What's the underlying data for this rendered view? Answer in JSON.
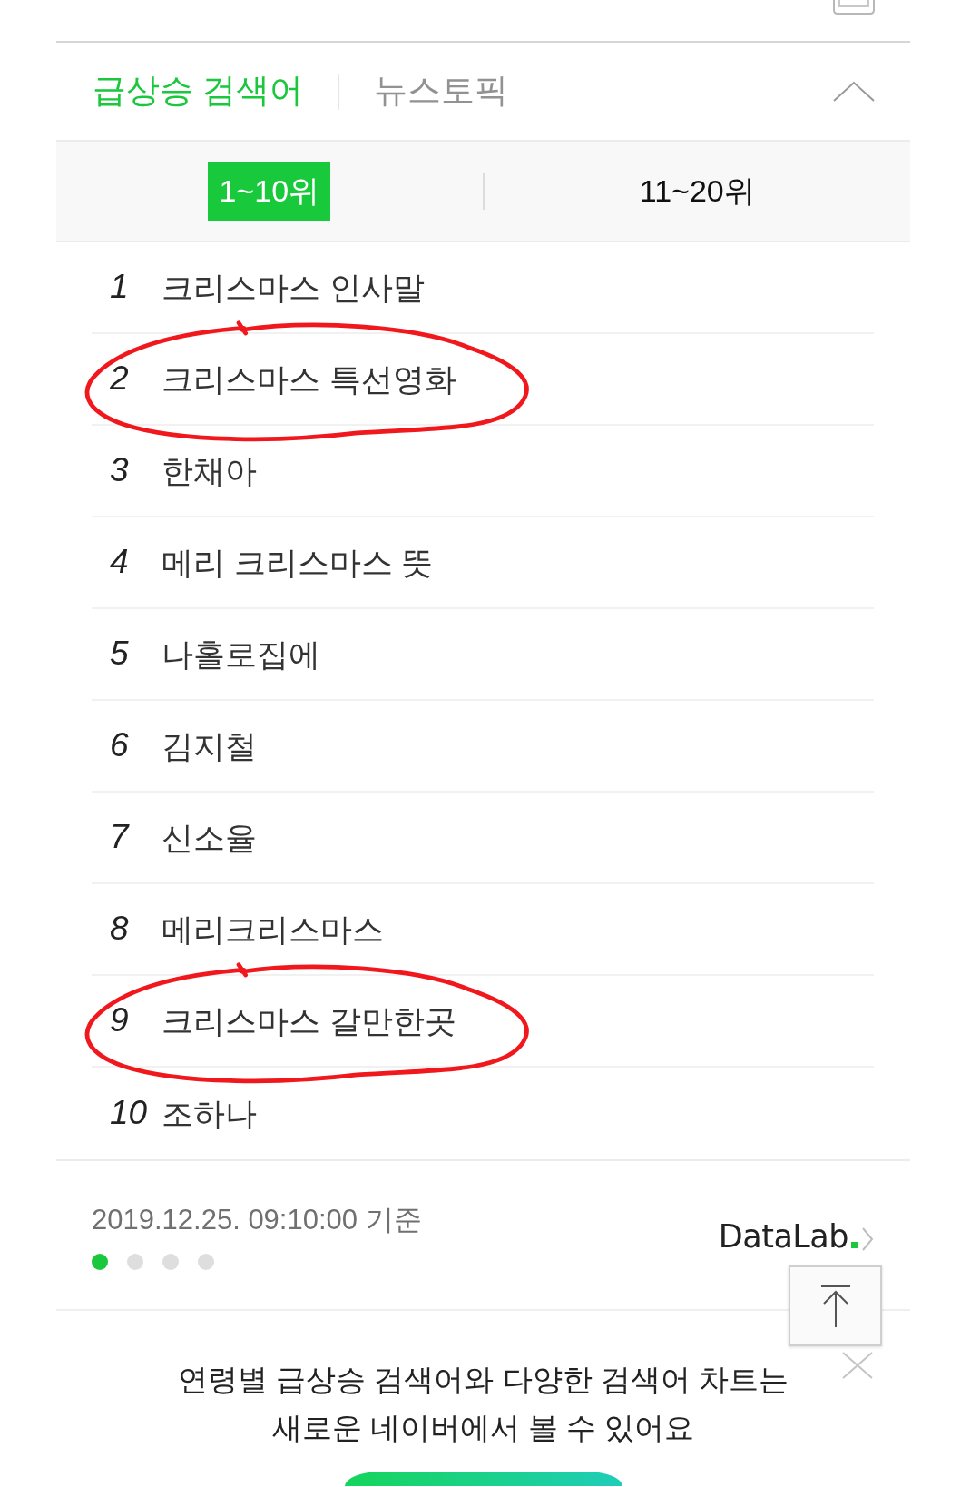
{
  "header": {
    "tabs": [
      {
        "label": "급상승 검색어",
        "selected": true
      },
      {
        "label": "뉴스토픽",
        "selected": false
      }
    ],
    "expanded": true
  },
  "range_tabs": [
    {
      "label": "1~10위",
      "selected": true
    },
    {
      "label": "11~20위",
      "selected": false
    }
  ],
  "items": [
    {
      "rank": "1",
      "keyword": "크리스마스 인사말",
      "circled": false
    },
    {
      "rank": "2",
      "keyword": "크리스마스 특선영화",
      "circled": true
    },
    {
      "rank": "3",
      "keyword": "한채아",
      "circled": false
    },
    {
      "rank": "4",
      "keyword": "메리 크리스마스 뜻",
      "circled": false
    },
    {
      "rank": "5",
      "keyword": "나홀로집에",
      "circled": false
    },
    {
      "rank": "6",
      "keyword": "김지철",
      "circled": false
    },
    {
      "rank": "7",
      "keyword": "신소율",
      "circled": false
    },
    {
      "rank": "8",
      "keyword": "메리크리스마스",
      "circled": false
    },
    {
      "rank": "9",
      "keyword": "크리스마스 갈만한곳",
      "circled": true
    },
    {
      "rank": "10",
      "keyword": "조하나",
      "circled": false
    }
  ],
  "footer": {
    "timestamp": "2019.12.25. 09:10:00 기준",
    "pages": [
      {
        "selected": true
      },
      {
        "selected": false
      },
      {
        "selected": false
      },
      {
        "selected": false
      }
    ],
    "datalab": "DataLab"
  },
  "promo": {
    "lines": [
      "연령별 급상승 검색어와 다양한 검색어 차트는",
      "새로운 네이버에서 볼 수 있어요"
    ]
  }
}
